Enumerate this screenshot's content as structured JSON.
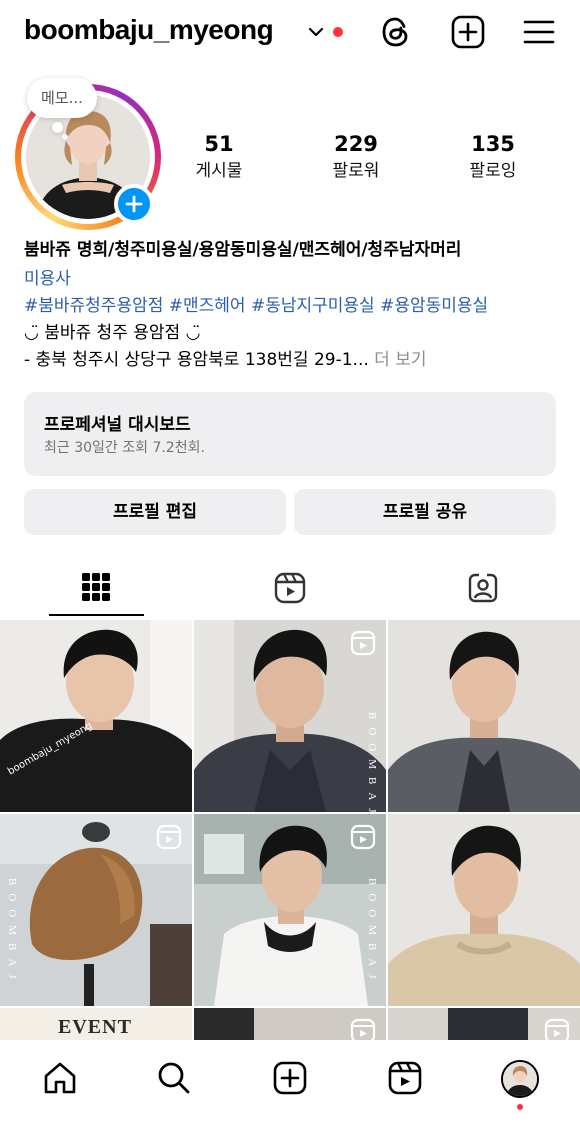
{
  "header": {
    "username": "boombaju_myeong",
    "icons": [
      "chevron-down-icon",
      "threads-icon",
      "new-post-icon",
      "menu-icon"
    ],
    "notification_color": "#ff3040"
  },
  "profile": {
    "memo": "메모...",
    "stats": [
      {
        "value": "51",
        "label": "게시물"
      },
      {
        "value": "229",
        "label": "팔로워"
      },
      {
        "value": "135",
        "label": "팔로잉"
      }
    ]
  },
  "bio": {
    "name": "붐바쥬 명희/청주미용실/용암동미용실/맨즈헤어/청주남자머리",
    "category": "미용사",
    "hashtags": "#붐바쥬청주용암점 #맨즈헤어 #동남지구미용실 #용암동미용실",
    "line1": "◡̈ 붐바쥬 청주 용암점 ◡̈",
    "line2": "- 충북 청주시 상당구 용암북로 138번길 29-1...",
    "more": " 더 보기"
  },
  "dashboard": {
    "title": "프로페셔널 대시보드",
    "subtitle": "최근 30일간 조회 7.2천회."
  },
  "buttons": {
    "edit": "프로필 편집",
    "share": "프로필 공유"
  },
  "tabs": [
    "grid-icon",
    "reels-icon",
    "tagged-icon"
  ],
  "grid": {
    "watermark": "boombaju_myeong",
    "vertical_brand": "BOOMBAJ",
    "event_label": "EVENT"
  },
  "nav": [
    "home-icon",
    "search-icon",
    "create-icon",
    "reels-icon",
    "profile-avatar"
  ],
  "colors": {
    "accent": "#0095f6",
    "link": "#2a5fb0"
  }
}
